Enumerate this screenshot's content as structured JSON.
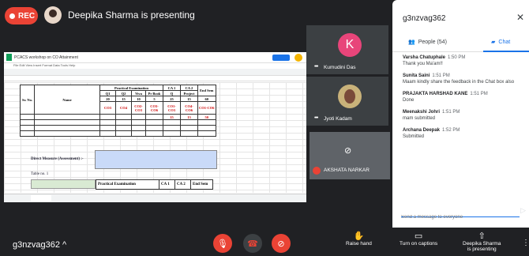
{
  "header": {
    "rec_label": "REC",
    "presenting_text": "Deepika Sharma is presenting"
  },
  "sheet": {
    "title": "PCACS workshop on CO Attainment",
    "menu": "File Edit View Insert Format Data Tools Help",
    "table": {
      "pe_header": "Practical Examination",
      "ca1": "CA 1",
      "ca2": "CA 2",
      "endsem": "End Sem",
      "q1": "Q1",
      "q2": "Q2",
      "viva": "Viva",
      "prbook": "Pr Book",
      "q": "Q",
      "project": "Project",
      "v20": "20",
      "v15a": "15",
      "v10": "10",
      "v5": "5",
      "v25": "25",
      "v15b": "15",
      "v60": "60",
      "srno": "Sr. No.",
      "name": "Name",
      "co3": "CO3",
      "co4": "CO4",
      "co2co3": "CO2-CO3",
      "co3co6": "CO3-CO6",
      "co1co3": "CO1-CO3",
      "co4co6": "CO4-CO6",
      "co1co6": "CO1-CO6",
      "r1": [
        "15",
        "13",
        "50"
      ]
    },
    "direct_measure": "Direct Measure (Assessment) :-",
    "table_a1": "Table no. 1",
    "pe_row": [
      "Practical Examination",
      "CA 1",
      "CA 2",
      "End Sem"
    ]
  },
  "tiles": {
    "kumudini": {
      "initial": "K",
      "name": "Kumudini Das"
    },
    "jyoti": {
      "name": "Jyoti Kadam"
    },
    "akshata": {
      "name": "AKSHATA NARKAR"
    }
  },
  "panel": {
    "code": "g3nzvag362",
    "people_tab": "People (54)",
    "chat_tab": "Chat",
    "messages": [
      {
        "name": "Varsha Chatuphale",
        "time": "1:50 PM",
        "text": "Thank you Ma'am!!"
      },
      {
        "name": "Sunita Saini",
        "time": "1:51 PM",
        "text": "Maam kindly share the feedback in the Chat box also"
      },
      {
        "name": "PRAJAKTA HARSHAD KANE",
        "time": "1:51 PM",
        "text": "Done"
      },
      {
        "name": "Meenakshi Johri",
        "time": "1:51 PM",
        "text": "mam submitted"
      },
      {
        "name": "Archana Deepak",
        "time": "1:52 PM",
        "text": "Submitted"
      }
    ],
    "input_placeholder": "Send a message to everyone"
  },
  "bottom": {
    "meeting_code": "g3nzvag362",
    "raise_hand": "Raise hand",
    "captions": "Turn on captions",
    "presenting_line1": "Deepika Sharma",
    "presenting_line2": "is presenting"
  },
  "colors": {
    "accent": "#1a73e8",
    "danger": "#ea4335",
    "bg": "#202124"
  }
}
